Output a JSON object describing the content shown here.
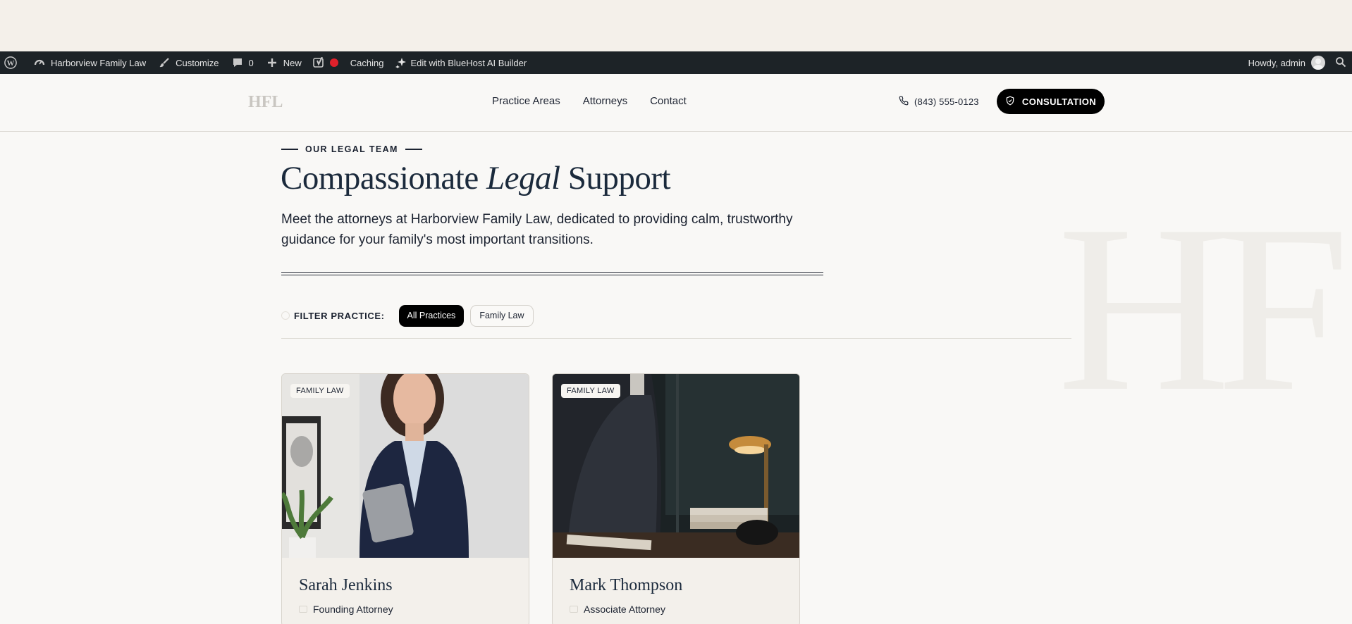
{
  "adminbar": {
    "site_name": "Harborview Family Law",
    "customize": "Customize",
    "comments_count": "0",
    "new": "New",
    "caching": "Caching",
    "ai_builder": "Edit with BlueHost AI Builder",
    "howdy": "Howdy, admin"
  },
  "header": {
    "logo": "HFL",
    "nav": [
      "Practice Areas",
      "Attorneys",
      "Contact"
    ],
    "phone": "(843) 555-0123",
    "cta": "CONSULTATION"
  },
  "hero": {
    "eyebrow": "OUR LEGAL TEAM",
    "title_pre": "Compassionate ",
    "title_em": "Legal",
    "title_post": " Support",
    "subtitle": "Meet the attorneys at Harborview Family Law, dedicated to providing calm, trustworthy guidance for your family's most important transitions.",
    "watermark": "HF"
  },
  "filter": {
    "label": "FILTER PRACTICE:",
    "chips": [
      "All Practices",
      "Family Law"
    ]
  },
  "attorneys": [
    {
      "badge": "FAMILY LAW",
      "name": "Sarah Jenkins",
      "role": "Founding Attorney"
    },
    {
      "badge": "FAMILY LAW",
      "name": "Mark Thompson",
      "role": "Associate Attorney"
    }
  ],
  "colors": {
    "admin_bar": "#1d2327",
    "accent_dark": "#000000",
    "heading": "#1b2a3c",
    "page_bg": "#f9f8f6"
  }
}
